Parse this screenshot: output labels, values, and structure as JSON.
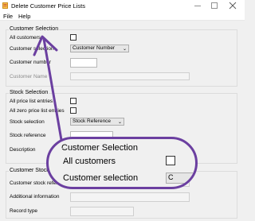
{
  "window": {
    "title": "Delete Customer Price Lists",
    "controls": {
      "minimize": "–",
      "maximize": "☐",
      "close": "✕"
    },
    "icon": "price-list-app-icon"
  },
  "menu": {
    "items": [
      "File",
      "Help"
    ]
  },
  "customer_selection": {
    "group_title": "Customer Selection",
    "all_customers_label": "All customers",
    "all_customers_checked": false,
    "selection_label": "Customer selection",
    "selection_value": "Customer Number",
    "number_label": "Customer number",
    "number_value": "",
    "name_label": "Customer Name",
    "name_value": ""
  },
  "stock_selection": {
    "group_title": "Stock Selection",
    "all_price_label": "All price list entries",
    "all_zero_label": "All zero price list entries",
    "selection_label": "Stock selection",
    "selection_value": "Stock Reference",
    "reference_label": "Stock reference",
    "reference_value": "",
    "description_label": "Description",
    "description_value": ""
  },
  "customer_stock": {
    "group_title": "Customer Stock Det",
    "reference_label": "Customer stock reference",
    "reference_value": "",
    "additional_label": "Additional information",
    "additional_value": "",
    "record_label": "Record type",
    "record_value": ""
  },
  "zoom_callout": {
    "group_title": "Customer Selection",
    "all_customers_label": "All customers",
    "selection_label": "Customer selection",
    "accent_color": "#6b3fa0"
  }
}
